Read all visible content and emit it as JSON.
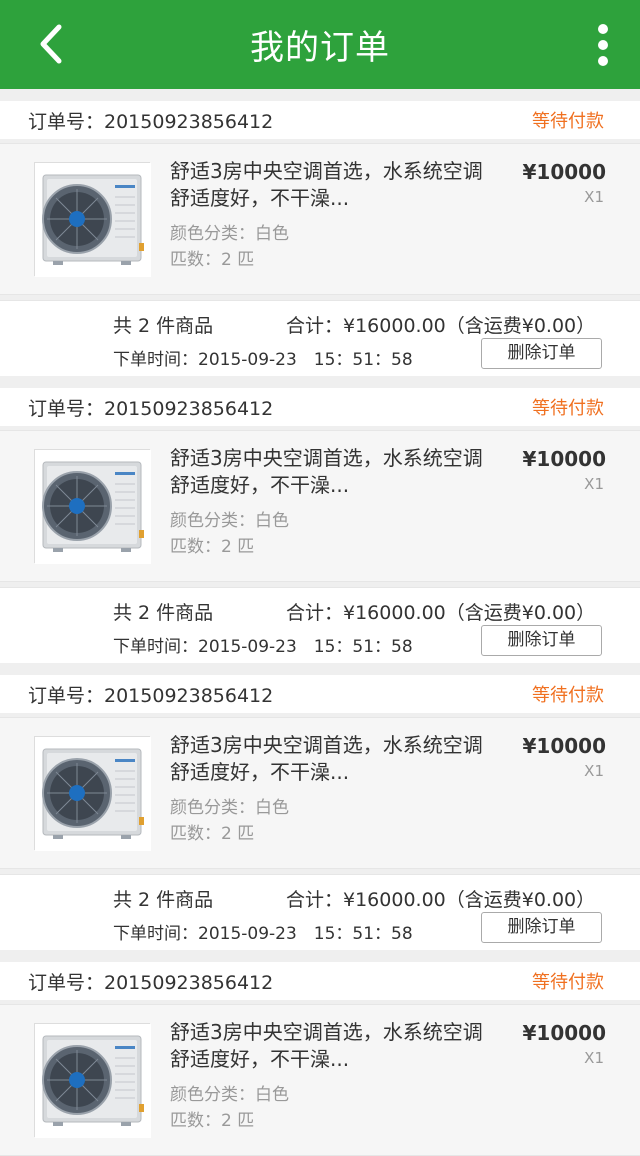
{
  "header": {
    "title": "我的订单"
  },
  "colors": {
    "header_bg": "#2ea23c",
    "status": "#f07020",
    "page_bg": "#efefef"
  },
  "orders": [
    {
      "order_no_label": "订单号：20150923856412",
      "status": "等待付款",
      "product": {
        "name": "舒适3房中央空调首选，水系统空调舒适度好，不干澡...",
        "color": "颜色分类：白色",
        "count": "匹数：2 匹",
        "price": "¥10000",
        "qty": "X1",
        "image_icon": "air-conditioner-image"
      },
      "total_count": "共 2 件商品",
      "total": "合计：¥16000.00（含运费¥0.00）",
      "time": "下单时间：2015-09-23　15：51：58",
      "delete_label": "删除订单"
    },
    {
      "order_no_label": "订单号：20150923856412",
      "status": "等待付款",
      "product": {
        "name": "舒适3房中央空调首选，水系统空调舒适度好，不干澡...",
        "color": "颜色分类：白色",
        "count": "匹数：2 匹",
        "price": "¥10000",
        "qty": "X1",
        "image_icon": "air-conditioner-image"
      },
      "total_count": "共 2 件商品",
      "total": "合计：¥16000.00（含运费¥0.00）",
      "time": "下单时间：2015-09-23　15：51：58",
      "delete_label": "删除订单"
    },
    {
      "order_no_label": "订单号：20150923856412",
      "status": "等待付款",
      "product": {
        "name": "舒适3房中央空调首选，水系统空调舒适度好，不干澡...",
        "color": "颜色分类：白色",
        "count": "匹数：2 匹",
        "price": "¥10000",
        "qty": "X1",
        "image_icon": "air-conditioner-image"
      },
      "total_count": "共 2 件商品",
      "total": "合计：¥16000.00（含运费¥0.00）",
      "time": "下单时间：2015-09-23　15：51：58",
      "delete_label": "删除订单"
    },
    {
      "order_no_label": "订单号：20150923856412",
      "status": "等待付款",
      "product": {
        "name": "舒适3房中央空调首选，水系统空调舒适度好，不干澡...",
        "color": "颜色分类：白色",
        "count": "匹数：2 匹",
        "price": "¥10000",
        "qty": "X1",
        "image_icon": "air-conditioner-image"
      }
    }
  ]
}
